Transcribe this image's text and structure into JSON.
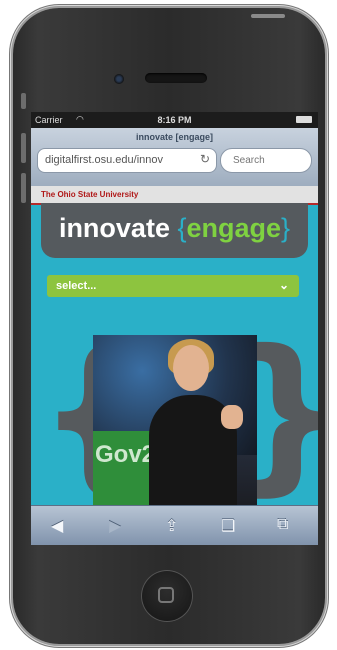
{
  "status_bar": {
    "carrier": "Carrier",
    "wifi_icon": "wifi-icon",
    "time": "8:16 PM",
    "battery_icon": "battery-icon"
  },
  "browser": {
    "page_title": "innovate [engage]",
    "url": "digitalfirst.osu.edu/innov",
    "search_placeholder": "Search",
    "reload_icon": "reload-icon"
  },
  "site": {
    "osu_name": "The Ohio State University",
    "brand": {
      "open_brace": "{",
      "innovate": "innovate ",
      "engage": "engage",
      "close_brace": "}"
    },
    "select_label": "select...",
    "select_arrow_icon": "chevron-down-icon",
    "photo_sign_text": "Gov2",
    "colors": {
      "background": "#2ab0c8",
      "banner": "#555a5e",
      "accent_green": "#8dc43f",
      "osu_red": "#b01818"
    }
  },
  "toolbar": {
    "back": "◀",
    "forward": "▶",
    "share": "⇪",
    "bookmarks": "❑",
    "tabs": "⧉"
  }
}
